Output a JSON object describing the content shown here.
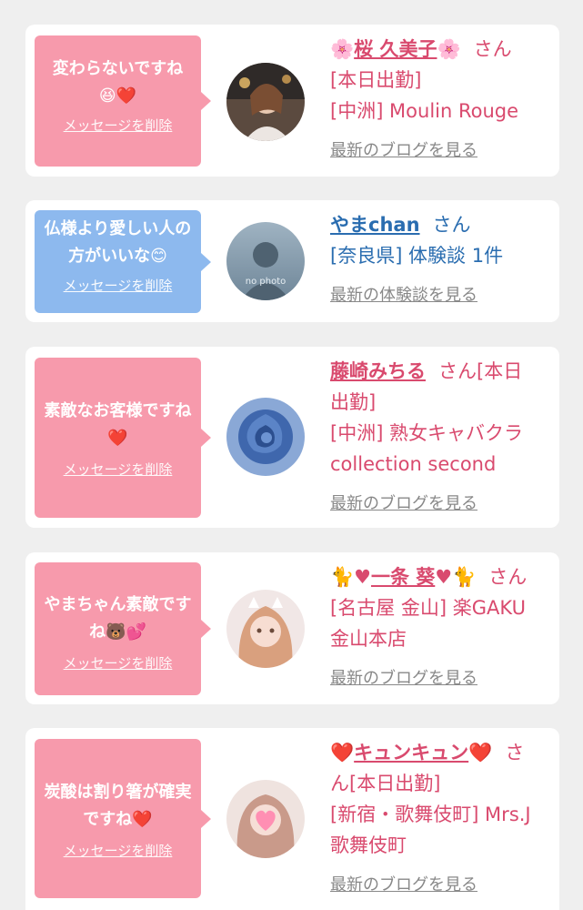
{
  "cards": [
    {
      "message": "変わらないですね",
      "message_emoji": "😆❤️",
      "delete_label": "メッセージを削除",
      "name_prefix": "🌸",
      "name": "桜 久美子",
      "name_suffix": "🌸",
      "san": "さん",
      "line1": "[本日出勤]",
      "line2": "[中洲] Moulin Rouge",
      "link": "最新のブログを見る"
    },
    {
      "message": "仏様より愛しい人の方がいいな",
      "message_emoji": "😊",
      "delete_label": "メッセージを削除",
      "name": "やまchan",
      "san": "さん",
      "avatar_text": "no photo",
      "line1": "[奈良県] 体験談 1件",
      "link": "最新の体験談を見る"
    },
    {
      "message": "素敵なお客様ですね",
      "message_emoji": "❤️",
      "delete_label": "メッセージを削除",
      "name": "藤崎みちる",
      "san": "さん[本日",
      "line1": "出勤]",
      "line2": "[中洲] 熟女キャバクラ",
      "line3": "collection second",
      "link": "最新のブログを見る"
    },
    {
      "message": "やまちゃん素敵ですね",
      "message_emoji": "🐻💕",
      "delete_label": "メッセージを削除",
      "name_prefix": "🐈♥",
      "name": "一条 葵",
      "name_suffix": "♥🐈",
      "san": "さん",
      "line1": "[名古屋 金山] 楽GAKU",
      "line2": "金山本店",
      "link": "最新のブログを見る"
    },
    {
      "message": "炭酸は割り箸が確実ですね",
      "message_emoji": "❤️",
      "delete_label": "メッセージを削除",
      "name_prefix": "❤️",
      "name": "キュンキュン",
      "name_suffix": "❤️",
      "san": "さ",
      "line1": "ん[本日出勤]",
      "line2": "[新宿・歌舞伎町] Mrs.J",
      "line3": "歌舞伎町",
      "link": "最新のブログを見る"
    }
  ]
}
